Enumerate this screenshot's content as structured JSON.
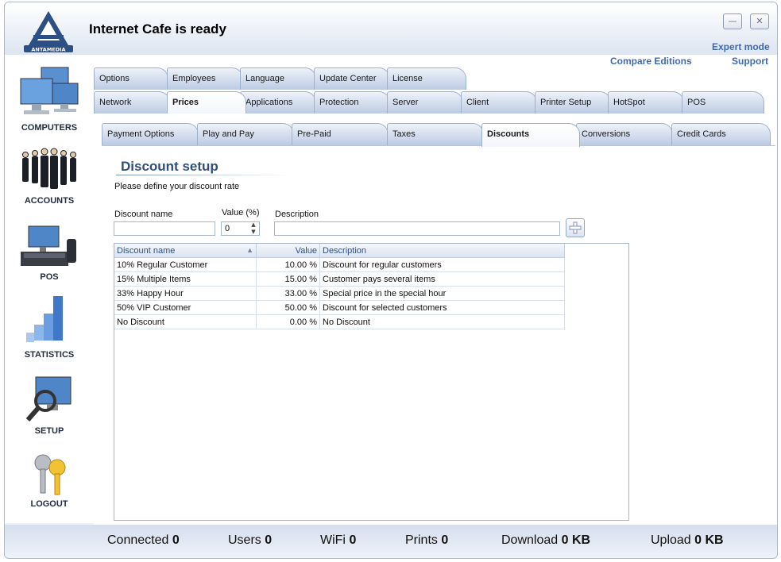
{
  "app": {
    "title": "Internet Cafe is ready",
    "brand": "ANTAMEDIA",
    "expert_mode": "Expert mode",
    "compare_editions": "Compare Editions",
    "support": "Support",
    "minimize_glyph": "—",
    "close_glyph": "✕"
  },
  "sidebar": {
    "items": [
      {
        "label": "COMPUTERS",
        "icon": "computers-icon"
      },
      {
        "label": "ACCOUNTS",
        "icon": "accounts-icon"
      },
      {
        "label": "POS",
        "icon": "pos-icon"
      },
      {
        "label": "STATISTICS",
        "icon": "statistics-icon"
      },
      {
        "label": "SETUP",
        "icon": "setup-icon"
      },
      {
        "label": "LOGOUT",
        "icon": "logout-icon"
      }
    ]
  },
  "tabs_row1": [
    "Options",
    "Employees",
    "Language",
    "Update Center",
    "License"
  ],
  "tabs_row2": [
    "Network",
    "Prices",
    "Applications",
    "Protection",
    "Server",
    "Client",
    "Printer Setup",
    "HotSpot",
    "POS"
  ],
  "subtabs": [
    "Payment Options",
    "Play and Pay",
    "Pre-Paid",
    "Taxes",
    "Discounts",
    "Conversions",
    "Credit Cards"
  ],
  "active_tab": "Prices",
  "active_subtab": "Discounts",
  "section": {
    "title": "Discount setup",
    "subtitle": "Please define your discount rate"
  },
  "form": {
    "name_label": "Discount name",
    "name_value": "",
    "value_label": "Value (%)",
    "value_value": "0",
    "desc_label": "Description",
    "desc_value": ""
  },
  "table": {
    "headers": {
      "name": "Discount name",
      "value": "Value",
      "desc": "Description"
    },
    "sort_indicator": "▲",
    "rows": [
      {
        "name": "10% Regular Customer",
        "value": "10.00 %",
        "desc": "Discount for regular customers"
      },
      {
        "name": "15% Multiple Items",
        "value": "15.00 %",
        "desc": "Customer pays several items"
      },
      {
        "name": "33% Happy Hour",
        "value": "33.00 %",
        "desc": "Special price in the special hour"
      },
      {
        "name": "50% VIP Customer",
        "value": "50.00 %",
        "desc": "Discount for selected customers"
      },
      {
        "name": "No Discount",
        "value": "0.00 %",
        "desc": "No Discount"
      }
    ]
  },
  "status": {
    "connected_label": "Connected",
    "connected": "0",
    "users_label": "Users",
    "users": "0",
    "wifi_label": "WiFi",
    "wifi": "0",
    "prints_label": "Prints",
    "prints": "0",
    "download_label": "Download",
    "download": "0 KB",
    "upload_label": "Upload",
    "upload": "0 KB"
  },
  "colors": {
    "accent": "#3e6ab0",
    "title_blue": "#2f4f7e",
    "tab_bg": "#bccbe3",
    "header_text": "#2d4f86"
  }
}
